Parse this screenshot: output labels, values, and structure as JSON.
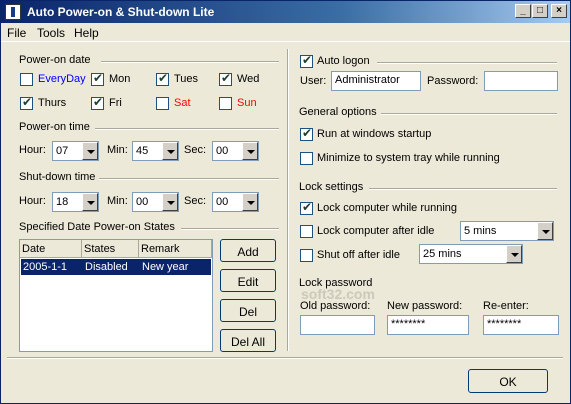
{
  "window": {
    "title": "Auto Power-on & Shut-down Lite",
    "controls": {
      "minimize": "_",
      "maximize": "□",
      "close": "×"
    }
  },
  "menu": [
    "File",
    "Tools",
    "Help"
  ],
  "power_on_date": {
    "heading": "Power-on date",
    "days": [
      {
        "label": "EveryDay",
        "checked": false,
        "color": "#0000ff"
      },
      {
        "label": "Mon",
        "checked": true,
        "color": "#000000"
      },
      {
        "label": "Tues",
        "checked": true,
        "color": "#000000"
      },
      {
        "label": "Wed",
        "checked": true,
        "color": "#000000"
      },
      {
        "label": "Thurs",
        "checked": true,
        "color": "#000000"
      },
      {
        "label": "Fri",
        "checked": true,
        "color": "#000000"
      },
      {
        "label": "Sat",
        "checked": false,
        "color": "#ff0000"
      },
      {
        "label": "Sun",
        "checked": false,
        "color": "#ff0000"
      }
    ]
  },
  "power_on_time": {
    "heading": "Power-on time",
    "hour_label": "Hour:",
    "hour": "07",
    "min_label": "Min:",
    "min": "45",
    "sec_label": "Sec:",
    "sec": "00"
  },
  "shut_down_time": {
    "heading": "Shut-down time",
    "hour_label": "Hour:",
    "hour": "18",
    "min_label": "Min:",
    "min": "00",
    "sec_label": "Sec:",
    "sec": "00"
  },
  "specified": {
    "heading": "Specified  Date Power-on  States",
    "columns": [
      "Date",
      "States",
      "Remark"
    ],
    "rows": [
      {
        "date": "2005-1-1",
        "state": "Disabled",
        "remark": "New year"
      }
    ],
    "buttons": [
      "Add",
      "Edit",
      "Del",
      "Del All"
    ]
  },
  "auto_logon": {
    "label": "Auto logon",
    "checked": true,
    "user_label": "User:",
    "user": "Administrator",
    "password_label": "Password:",
    "password": ""
  },
  "general": {
    "heading": "General options",
    "options": [
      {
        "label": "Run at windows startup",
        "checked": true
      },
      {
        "label": "Minimize to system tray while running",
        "checked": false
      }
    ]
  },
  "lock": {
    "heading": "Lock settings",
    "lock_running": {
      "label": "Lock computer while running",
      "checked": true
    },
    "lock_idle": {
      "label": "Lock computer after idle",
      "checked": false,
      "value": "5 mins"
    },
    "shut_idle": {
      "label": "Shut off after idle",
      "checked": false,
      "value": "25 mins"
    }
  },
  "lock_password": {
    "heading": "Lock password",
    "old_label": "Old password:",
    "old": "",
    "new_label": "New password:",
    "new": "********",
    "reenter_label": "Re-enter:",
    "reenter": "********"
  },
  "ok_label": "OK",
  "watermark": "soft32.com"
}
